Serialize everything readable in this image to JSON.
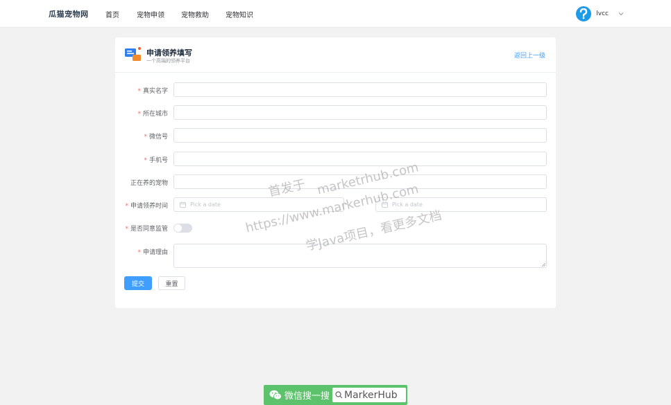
{
  "header": {
    "brand": "瓜猫宠物网",
    "nav": [
      "首页",
      "宠物申领",
      "宠物救助",
      "宠物知识"
    ],
    "username": "lvcc"
  },
  "card": {
    "title": "申请领养填写",
    "subtitle": "一个高端的领养平台",
    "back": "返回上一级"
  },
  "form": {
    "real_name": {
      "label": "真实名字",
      "value": ""
    },
    "city": {
      "label": "所在城市",
      "value": ""
    },
    "wechat": {
      "label": "微信号",
      "value": ""
    },
    "phone": {
      "label": "手机号",
      "value": ""
    },
    "current_pets": {
      "label": "正在养的宠物",
      "value": ""
    },
    "apply_time": {
      "label": "申请领养时间",
      "start_placeholder": "Pick a date",
      "end_placeholder": "Pick a date",
      "separator": "-"
    },
    "supervise": {
      "label": "是否同意监管",
      "on": false
    },
    "reason": {
      "label": "申请理由",
      "value": ""
    },
    "submit": "提交",
    "reset": "重置"
  },
  "watermark": {
    "line1": "首发于",
    "line2": "marketrhub.com",
    "line3": "https://www.markerhub.com",
    "line4": "学Java项目，看更多文档"
  },
  "badge": {
    "text": "微信搜一搜",
    "search": "MarkerHub"
  },
  "colors": {
    "primary": "#409eff",
    "required": "#f56c6c",
    "wechat": "#5dc26c"
  }
}
